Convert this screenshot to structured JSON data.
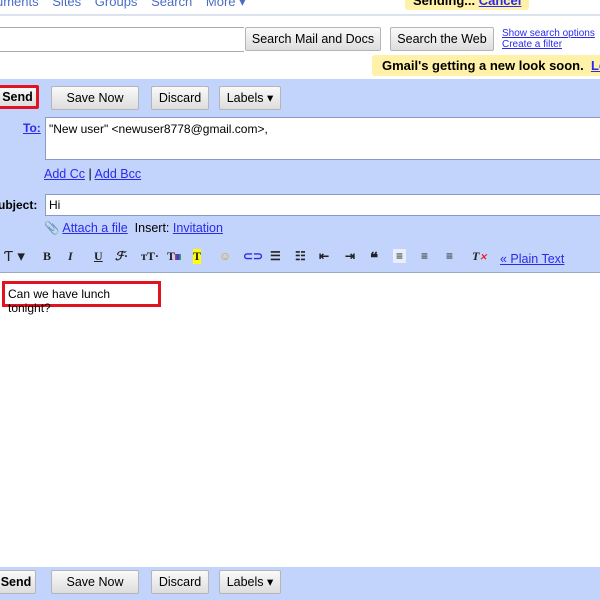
{
  "topnav": {
    "items": [
      "uments",
      "Sites",
      "Groups",
      "Search",
      "More ▾"
    ],
    "status": "Sending...",
    "status_link": "Cancel"
  },
  "search": {
    "value": "",
    "mail_button": "Search Mail and Docs",
    "web_button": "Search the Web",
    "show_options": "Show search options",
    "create_filter": "Create a filter"
  },
  "banner": {
    "text": "Gmail's getting a new look soon.",
    "link": "Le"
  },
  "actions": {
    "send": "Send",
    "save": "Save Now",
    "discard": "Discard",
    "labels": "Labels ▾"
  },
  "compose": {
    "to_label": "To:",
    "to_value": "\"New user\" <newuser8778@gmail.com>,",
    "add_cc": "Add Cc",
    "sep": "|",
    "add_bcc": "Add Bcc",
    "subject_label": "Subject:",
    "subject_value": "Hi",
    "attach": "Attach a file",
    "insert_label": "Insert:",
    "invitation": "Invitation"
  },
  "toolbar": {
    "plain_text": "« Plain Text"
  },
  "body": {
    "text": "Can we have lunch tonight?"
  },
  "colors": {
    "panel": "#c3d4fc",
    "highlight": "#e0141e",
    "banner": "#fff1a8"
  }
}
